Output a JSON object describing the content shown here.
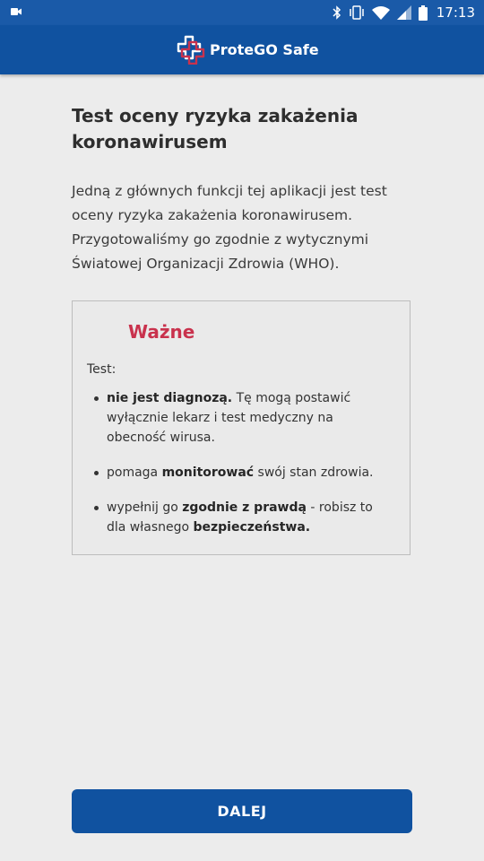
{
  "status_bar": {
    "time": "17:13",
    "icons": [
      "camera-icon",
      "bluetooth-icon",
      "vibrate-icon",
      "wifi-icon",
      "signal-icon",
      "battery-icon"
    ]
  },
  "header": {
    "app_name": "ProteGO Safe",
    "logo_icon": "protego-cross-logo",
    "colors": {
      "bar": "#1052a0",
      "logo_red": "#c9324d"
    }
  },
  "main": {
    "title": "Test oceny ryzyka zakażenia koronawirusem",
    "intro": "Jedną z głównych funkcji tej aplikacji jest test oceny ryzyka zakażenia koronawirusem. Przygotowaliśmy go zgodnie z wytycznymi Światowej Organizacji Zdrowia (WHO)."
  },
  "info_box": {
    "title": "Ważne",
    "lead": "Test:",
    "items": [
      {
        "parts": [
          {
            "b": "nie jest diagnozą."
          },
          {
            "t": " Tę mogą postawić wyłącznie lekarz i test medyczny na obecność wirusa."
          }
        ]
      },
      {
        "parts": [
          {
            "t": "pomaga "
          },
          {
            "b": "monitorować"
          },
          {
            "t": " swój stan zdrowia."
          }
        ]
      },
      {
        "parts": [
          {
            "t": "wypełnij go "
          },
          {
            "b": "zgodnie z prawdą"
          },
          {
            "t": " - robisz to dla własnego "
          },
          {
            "b": "bezpieczeństwa."
          }
        ]
      }
    ],
    "colors": {
      "accent": "#c9324d"
    }
  },
  "footer": {
    "next_label": "DALEJ"
  }
}
